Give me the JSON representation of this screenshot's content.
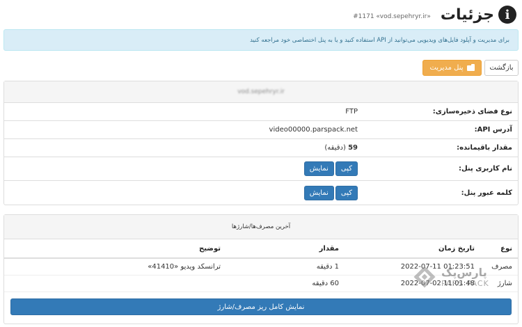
{
  "header": {
    "title": "جزئیات",
    "subtitle": "#1171 «vod.sepehryr.ir»"
  },
  "info": {
    "text": "برای مدیریت و آپلود فایل‌های ویدیویی می‌توانید از API استفاده کنید و یا به پنل اختصاصی خود مراجعه کنید"
  },
  "toolbar": {
    "back_label": "بازگشت",
    "panel_label": "پنل مدیریت"
  },
  "details": {
    "domain": "vod.sepehryr.ir",
    "rows": [
      {
        "label": "نوع فضای ذخیره‌سازی:",
        "value": "FTP"
      },
      {
        "label": "آدرس API:",
        "value": "video00000.parspack.net"
      },
      {
        "label": "مقدار باقیمانده:",
        "value_bold": "59",
        "value_unit": "(دقیقه)"
      },
      {
        "label": "نام کاربری پنل:"
      },
      {
        "label": "کلمه عبور پنل:"
      }
    ],
    "copy_label": "کپی",
    "show_label": "نمایش"
  },
  "usage": {
    "heading": "آخرین مصرف‌ها/شارژها",
    "columns": [
      "نوع",
      "تاریخ زمان",
      "مقدار",
      "توضیح"
    ],
    "rows": [
      {
        "type": "مصرف",
        "datetime": "2022-07-11 01:23:51",
        "amount": "1 دقیقه",
        "desc": "ترانسکد ویدیو «41410»"
      },
      {
        "type": "شارژ",
        "datetime": "2022-07-02 11:01:48",
        "amount": "60 دقیقه",
        "desc": ""
      }
    ],
    "full_button": "نمایش کامل ریز مصرف/شارژ"
  },
  "logo": {
    "fa": "پارس‌پک",
    "en": "PARS PACK"
  },
  "colors": {
    "primary": "#337ab7",
    "warning": "#f0ad4e",
    "info_bg": "#d9edf7"
  }
}
